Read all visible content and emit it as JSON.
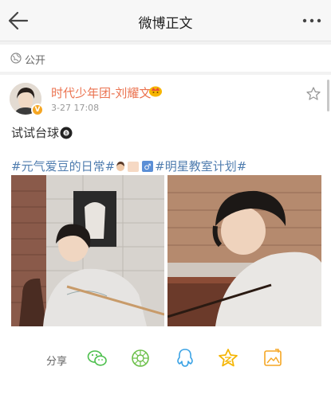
{
  "navbar": {
    "title": "微博正文"
  },
  "visibility": {
    "label": "公开"
  },
  "post": {
    "author": "时代少年团-刘耀文",
    "time": "3-27 17:08",
    "text": "试试台球",
    "hashtag_1": "#元气爱豆的日常#",
    "hashtag_2": "#明星教室计划#"
  },
  "share": {
    "label": "分享"
  },
  "colors": {
    "accent": "#eb7350",
    "link": "#507daf",
    "vip": "#f5a623"
  },
  "icons": [
    "back-arrow-icon",
    "more-icon",
    "globe-icon",
    "verified-icon",
    "crown-icon",
    "star-icon",
    "eight-ball-icon",
    "wechat-icon",
    "moments-icon",
    "qq-icon",
    "qzone-icon",
    "album-icon"
  ]
}
